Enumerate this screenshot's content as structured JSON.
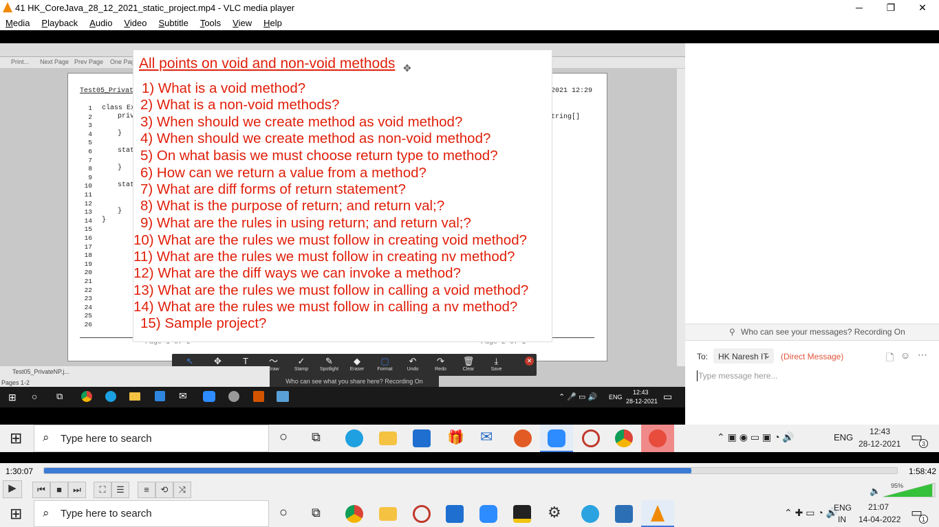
{
  "window": {
    "title": "41 HK_CoreJava_28_12_2021_static_project.mp4 - VLC media player",
    "minimize": "─",
    "restore": "❐",
    "close": "✕"
  },
  "menu": [
    "Media",
    "Playback",
    "Audio",
    "Video",
    "Subtitle",
    "Tools",
    "View",
    "Help"
  ],
  "inner_app": {
    "toolbar_buttons": [
      "Print...",
      "Next Page",
      "Prev Page",
      "One Page"
    ],
    "doc_header_left": "Test05_Privat",
    "doc_header_right": "2021 12:29",
    "code_right": "tring[]",
    "line_numbers": [
      "1",
      "2",
      "3",
      "4",
      "5",
      "6",
      "7",
      "8",
      "9",
      "10",
      "11",
      "12",
      "13",
      "14",
      "15",
      "16",
      "17",
      "18",
      "19",
      "20",
      "21",
      "22",
      "23",
      "24",
      "25",
      "26"
    ],
    "code_lines": [
      "class Ex",
      "priv",
      "}",
      "stat",
      "}",
      "stat",
      "}",
      "}"
    ],
    "page_left": "Page 1 of 2",
    "page_right": "Page 2 of 2",
    "status_file": "Test05_PrivateNP.j...",
    "status_pages": "Pages 1-2"
  },
  "slide": {
    "title": "All points on void and non-void methods",
    "questions": [
      "1) What is a void method?",
      "2) What is a non-void methods?",
      "3) When should we create method as void method?",
      "4) When should we create method as non-void method?",
      "5)  On what basis we must choose return type to method?",
      "6)  How can we return a value from a method?",
      "7) What are diff forms of return statement?",
      "8) What is the purpose of return; and return val;?",
      "9) What are the rules in using return; and return val;?",
      "10) What are the rules we must follow in creating void method?",
      "11) What are the rules we must follow in creating nv method?",
      "12) What are the diff ways we can invoke a method?",
      "13) What are the rules we must follow in calling a void method?",
      "14) What are the rules we must follow in calling a nv method?",
      "15)  Sample project?"
    ]
  },
  "zoom_toolbar": {
    "tools": [
      {
        "label": "Mouse",
        "icon": "↖"
      },
      {
        "label": "Select",
        "icon": "✥"
      },
      {
        "label": "Text",
        "icon": "T"
      },
      {
        "label": "Draw",
        "icon": "〜"
      },
      {
        "label": "Stamp",
        "icon": "✓"
      },
      {
        "label": "Spotlight",
        "icon": "✎"
      },
      {
        "label": "Eraser",
        "icon": "◆"
      },
      {
        "label": "Format",
        "icon": "▢"
      },
      {
        "label": "Undo",
        "icon": "↶"
      },
      {
        "label": "Redo",
        "icon": "↷"
      },
      {
        "label": "Clear",
        "icon": "🗑"
      },
      {
        "label": "Save",
        "icon": "⤓"
      }
    ],
    "note": "Who can see what you share here? Recording On"
  },
  "inner_taskbar": {
    "time": "12:43",
    "date": "28-12-2021",
    "lang": "ENG"
  },
  "chat": {
    "visibility": "Who can see your messages? Recording On",
    "to_label": "To:",
    "recipient": "HK Naresh IT",
    "dm_label": "(Direct Message)",
    "placeholder": "Type message here..."
  },
  "taskbar_recorded": {
    "search_placeholder": "Type here to search",
    "lang": "ENG",
    "time": "12:43",
    "date": "28-12-2021",
    "notifications": "3"
  },
  "player": {
    "elapsed": "1:30:07",
    "total": "1:58:42",
    "progress_fraction": 0.759,
    "volume_percent": "95%",
    "volume_fraction": 0.95
  },
  "taskbar_host": {
    "search_placeholder": "Type here to search",
    "lang": "ENG",
    "region": "IN",
    "time": "21:07",
    "date": "14-04-2022",
    "notifications": "1"
  }
}
